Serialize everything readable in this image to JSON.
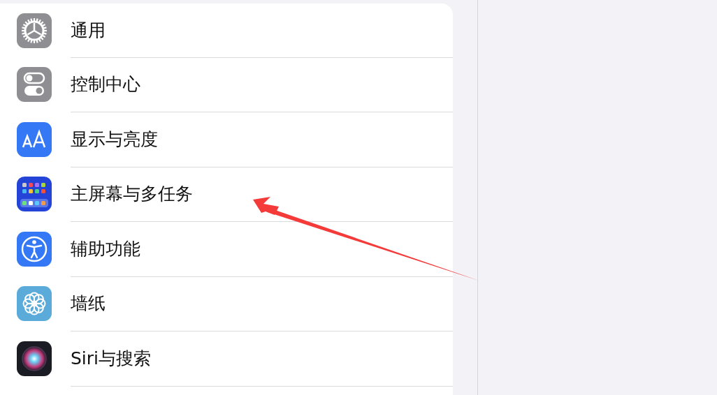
{
  "settings_list": [
    {
      "label": "通用"
    },
    {
      "label": "控制中心"
    },
    {
      "label": "显示与亮度"
    },
    {
      "label": "主屏幕与多任务"
    },
    {
      "label": "辅助功能"
    },
    {
      "label": "墙纸"
    },
    {
      "label": "Siri与搜索"
    }
  ]
}
